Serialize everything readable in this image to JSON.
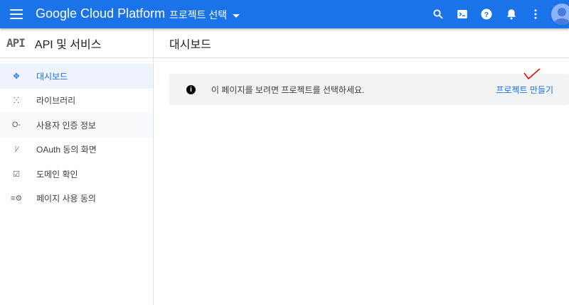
{
  "header": {
    "brand": "Google Cloud Platform",
    "project_selector": "프로젝트 선택"
  },
  "sidebar": {
    "logo": "API",
    "title": "API 및 서비스",
    "items": [
      {
        "label": "대시보드",
        "icon": "dashboard-icon"
      },
      {
        "label": "라이브러리",
        "icon": "library-icon"
      },
      {
        "label": "사용자 인증 정보",
        "icon": "key-icon"
      },
      {
        "label": "OAuth 동의 화면",
        "icon": "consent-icon"
      },
      {
        "label": "도메인 확인",
        "icon": "checkbox-icon"
      },
      {
        "label": "페이지 사용 동의",
        "icon": "settings-list-icon"
      }
    ]
  },
  "main": {
    "title": "대시보드",
    "banner": {
      "message": "이 페이지를 보려면 프로젝트를 선택하세요.",
      "action": "프로젝트 만들기"
    }
  },
  "colors": {
    "accent": "#1a73e8",
    "annotation": "#ff0000"
  }
}
